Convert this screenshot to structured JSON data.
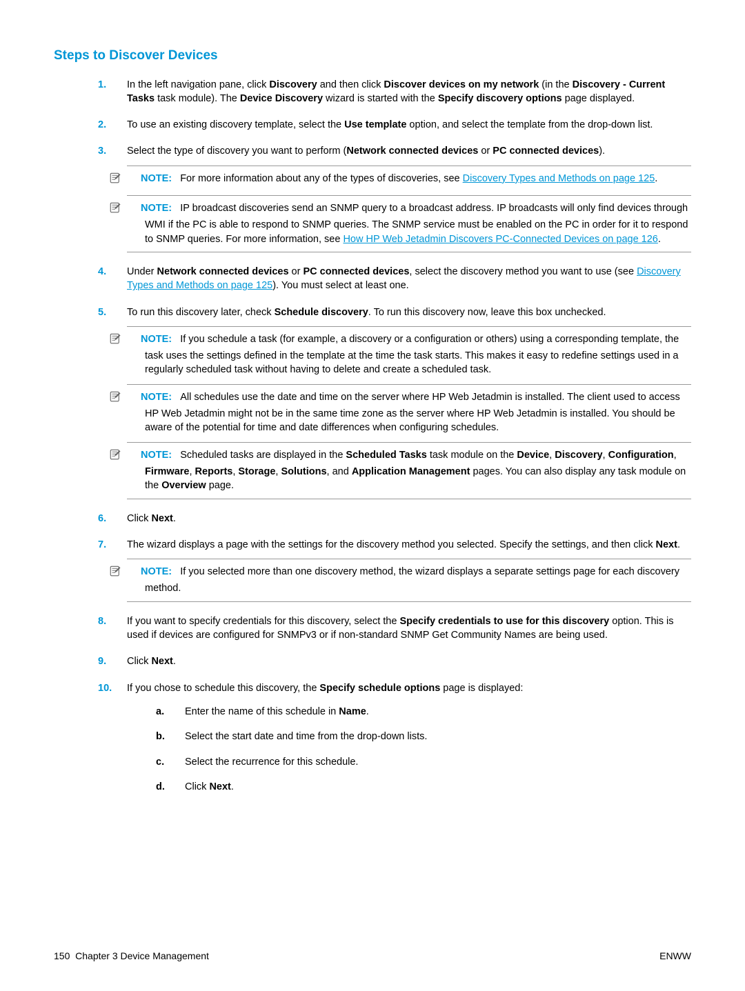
{
  "heading": "Steps to Discover Devices",
  "steps": {
    "s1": {
      "num": "1.",
      "text_before": "In the left navigation pane, click ",
      "b1": "Discovery",
      "t2": " and then click ",
      "b2": "Discover devices on my network",
      "t3": " (in the ",
      "b3": "Discovery - Current Tasks",
      "t4": " task module). The ",
      "b4": "Device Discovery",
      "t5": " wizard is started with the ",
      "b5": "Specify discovery options",
      "t6": " page displayed."
    },
    "s2": {
      "num": "2.",
      "t1": "To use an existing discovery template, select the ",
      "b1": "Use template",
      "t2": " option, and select the template from the drop-down list."
    },
    "s3": {
      "num": "3.",
      "t1": "Select the type of discovery you want to perform (",
      "b1": "Network connected devices",
      "t2": " or ",
      "b2": "PC connected devices",
      "t3": ").",
      "note1": {
        "label": "NOTE:",
        "t1": "For more information about any of the types of discoveries, see ",
        "link": "Discovery Types and Methods on page 125",
        "t2": "."
      },
      "note2": {
        "label": "NOTE:",
        "t1": "IP broadcast discoveries send an SNMP query to a broadcast address. IP broadcasts will only find devices through WMI if the PC is able to respond to SNMP queries. The SNMP service must be enabled on the PC in order for it to respond to SNMP queries. For more information, see ",
        "link": "How HP Web Jetadmin Discovers PC-Connected Devices on page 126",
        "t2": "."
      }
    },
    "s4": {
      "num": "4.",
      "t1": "Under ",
      "b1": "Network connected devices",
      "t2": " or ",
      "b2": "PC connected devices",
      "t3": ", select the discovery method you want to use (see ",
      "link": "Discovery Types and Methods on page 125",
      "t4": "). You must select at least one."
    },
    "s5": {
      "num": "5.",
      "t1": "To run this discovery later, check ",
      "b1": "Schedule discovery",
      "t2": ". To run this discovery now, leave this box unchecked.",
      "note1": {
        "label": "NOTE:",
        "t1": "If you schedule a task (for example, a discovery or a configuration or others) using a corresponding template, the task uses the settings defined in the template at the time the task starts. This makes it easy to redefine settings used in a regularly scheduled task without having to delete and create a scheduled task."
      },
      "note2": {
        "label": "NOTE:",
        "t1": "All schedules use the date and time on the server where HP Web Jetadmin is installed. The client used to access HP Web Jetadmin might not be in the same time zone as the server where HP Web Jetadmin is installed. You should be aware of the potential for time and date differences when configuring schedules."
      },
      "note3": {
        "label": "NOTE:",
        "t1": "Scheduled tasks are displayed in the ",
        "b1": "Scheduled Tasks",
        "t2": " task module on the ",
        "b2": "Device",
        "t3": ", ",
        "b3": "Discovery",
        "t4": ", ",
        "b4": "Configuration",
        "t5": ", ",
        "b5": "Firmware",
        "t6": ", ",
        "b6": "Reports",
        "t7": ", ",
        "b7": "Storage",
        "t8": ", ",
        "b8": "Solutions",
        "t9": ", and ",
        "b9": "Application Management",
        "t10": " pages. You can also display any task module on the ",
        "b10": "Overview",
        "t11": " page."
      }
    },
    "s6": {
      "num": "6.",
      "t1": "Click ",
      "b1": "Next",
      "t2": "."
    },
    "s7": {
      "num": "7.",
      "t1": "The wizard displays a page with the settings for the discovery method you selected. Specify the settings, and then click ",
      "b1": "Next",
      "t2": ".",
      "note1": {
        "label": "NOTE:",
        "t1": "If you selected more than one discovery method, the wizard displays a separate settings page for each discovery method."
      }
    },
    "s8": {
      "num": "8.",
      "t1": "If you want to specify credentials for this discovery, select the ",
      "b1": "Specify credentials to use for this discovery",
      "t2": " option. This is used if devices are configured for SNMPv3 or if non-standard SNMP Get Community Names are being used."
    },
    "s9": {
      "num": "9.",
      "t1": "Click ",
      "b1": "Next",
      "t2": "."
    },
    "s10": {
      "num": "10.",
      "t1": "If you chose to schedule this discovery, the ",
      "b1": "Specify schedule options",
      "t2": " page is displayed:",
      "sub": {
        "a": {
          "alpha": "a.",
          "t1": "Enter the name of this schedule in ",
          "b1": "Name",
          "t2": "."
        },
        "b": {
          "alpha": "b.",
          "t1": "Select the start date and time from the drop-down lists."
        },
        "c": {
          "alpha": "c.",
          "t1": "Select the recurrence for this schedule."
        },
        "d": {
          "alpha": "d.",
          "t1": "Click ",
          "b1": "Next",
          "t2": "."
        }
      }
    }
  },
  "footer": {
    "left_page": "150",
    "left_text": "Chapter 3   Device Management",
    "right": "ENWW"
  }
}
